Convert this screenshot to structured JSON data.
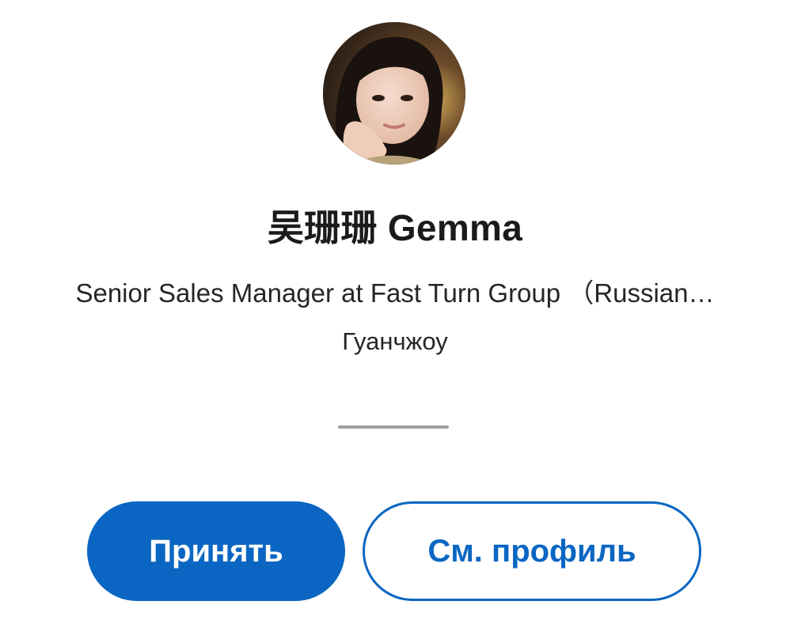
{
  "profile": {
    "name": "吴珊珊 Gemma",
    "headline": "Senior Sales Manager at Fast Turn Group （Russian…",
    "location": "Гуанчжоу",
    "avatar_icon": "profile-photo"
  },
  "actions": {
    "accept_label": "Принять",
    "view_profile_label": "См. профиль"
  },
  "colors": {
    "accent": "#0a66c2",
    "divider": "#9e9e9e"
  }
}
